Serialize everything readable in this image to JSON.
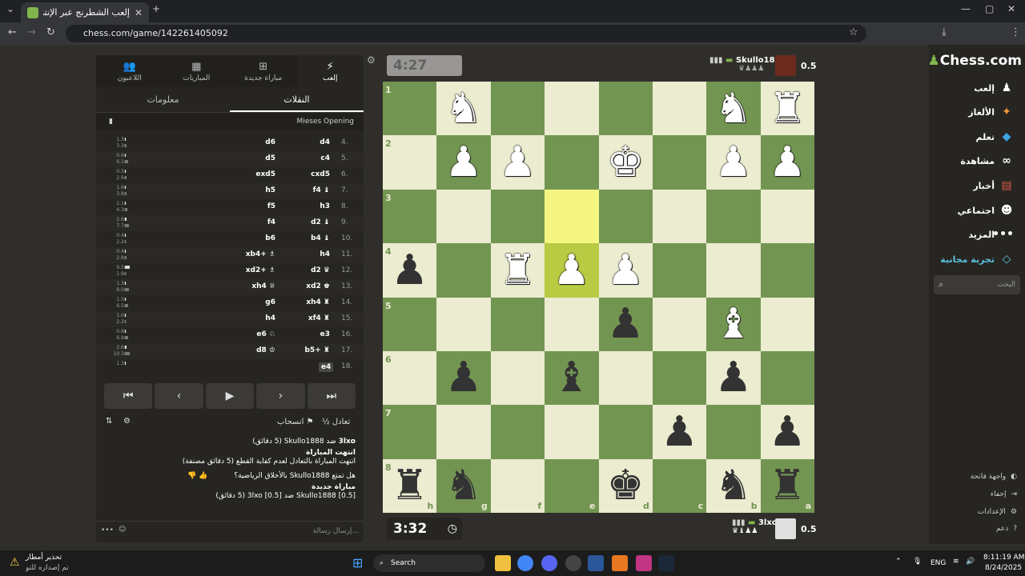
{
  "browser": {
    "tab_title": "إلعب الشطرنج عبر الإنترنت مجانًا",
    "url": "chess.com/game/142261405092"
  },
  "left_panel": {
    "top_tabs": [
      {
        "label": "إلعب",
        "icon": "bolt-icon"
      },
      {
        "label": "مباراة جديدة",
        "icon": "plus-icon"
      },
      {
        "label": "المباريات",
        "icon": "board-icon"
      },
      {
        "label": "اللاعبون",
        "icon": "people-icon"
      }
    ],
    "sub_tabs": [
      {
        "label": "النقلات"
      },
      {
        "label": "معلومات"
      }
    ],
    "opening": "Mieses Opening",
    "moves": [
      {
        "num": "4.",
        "white": "d4",
        "black": "d6",
        "wt": "1.3s",
        "bt": "3.3s"
      },
      {
        "num": "5.",
        "white": "c4",
        "black": "d5",
        "wt": "0.6s",
        "bt": "6.1s"
      },
      {
        "num": "6.",
        "white": "cxd5",
        "black": "exd5",
        "wt": "0.5s",
        "bt": "2.6s"
      },
      {
        "num": "7.",
        "white": "f4 ♝",
        "black": "h5",
        "wt": "1.6s",
        "bt": "3.8s"
      },
      {
        "num": "8.",
        "white": "h3",
        "black": "f5",
        "wt": "2.1s",
        "bt": "4.3s"
      },
      {
        "num": "9.",
        "white": "d2 ♝",
        "black": "f4",
        "wt": "2.6s",
        "bt": "7.7s"
      },
      {
        "num": "10.",
        "white": "b4 ♝",
        "black": "b6",
        "wt": "0.4s",
        "bt": "2.2s"
      },
      {
        "num": "11.",
        "white": "h4",
        "black": "xb4+ ♗",
        "wt": "0.4s",
        "bt": "2.8s"
      },
      {
        "num": "12.",
        "white": "d2 ♛",
        "black": "xd2+ ♗",
        "wt": "9.5s",
        "bt": "1.9s"
      },
      {
        "num": "13.",
        "white": "xd2 ♚",
        "black": "xh4 ♕",
        "wt": "1.3s",
        "bt": "8.0s"
      },
      {
        "num": "14.",
        "white": "xh4 ♜",
        "black": "g6",
        "wt": "1.5s",
        "bt": "6.5s"
      },
      {
        "num": "15.",
        "white": "xf4 ♜",
        "black": "h4",
        "wt": "1.0s",
        "bt": "2.2s"
      },
      {
        "num": "16.",
        "white": "e3",
        "black": "e6 ♘",
        "wt": "0.8s",
        "bt": "6.8s"
      },
      {
        "num": "17.",
        "white": "b5+ ♜",
        "black": "d8 ♔",
        "wt": "2.6s",
        "bt": "10.3s"
      },
      {
        "num": "18.",
        "white": "e4",
        "black": "",
        "wt": "1.3s",
        "bt": ""
      }
    ],
    "actions": {
      "draw": "½ تعادل",
      "resign": "انسحاب"
    },
    "chat": [
      {
        "bold": "3lxo",
        "text": " ضد Skullo1888 (5 دقائق)"
      },
      {
        "bold": "انتهت المباراة",
        "text": ""
      },
      {
        "bold": "",
        "text": "انتهت المباراة بالتعادل لعدم كفاية القطع (5 دقائق مصنفة)"
      },
      {
        "bold": "",
        "text": "هل تمتع Skullo1888 بالأخلاق الرياضية؟"
      },
      {
        "bold": "مباراة جديدة",
        "text": ""
      },
      {
        "bold": "",
        "text": "[0.5] Skullo1888 ضد [0.5] 3lxo (5 دقائق)"
      }
    ],
    "chat_placeholder": "إرسال رسالة..."
  },
  "game": {
    "top_clock": "4:27",
    "bottom_clock": "3:32",
    "top_player": {
      "name": "Skullo1888",
      "score": "0.5"
    },
    "bottom_player": {
      "name": "3lxo",
      "score": "0.5"
    },
    "rank_labels": [
      "1",
      "2",
      "3",
      "4",
      "5",
      "6",
      "7",
      "8"
    ],
    "file_labels": [
      "h",
      "g",
      "f",
      "e",
      "d",
      "c",
      "b",
      "a"
    ]
  },
  "sidebar": {
    "logo": "Chess.com",
    "items": [
      {
        "label": "إلعب",
        "icon": "pawn-icon"
      },
      {
        "label": "الألغاز",
        "icon": "puzzle-icon"
      },
      {
        "label": "تعلم",
        "icon": "graduation-icon"
      },
      {
        "label": "مشاهدة",
        "icon": "binoculars-icon"
      },
      {
        "label": "أخبار",
        "icon": "newspaper-icon"
      },
      {
        "label": "اجتماعي",
        "icon": "people-icon"
      },
      {
        "label": "المزيد",
        "icon": "more-icon"
      },
      {
        "label": "تجربة مجانية",
        "icon": "diamond-icon"
      }
    ],
    "search_placeholder": "البحث",
    "footer": [
      {
        "label": "واجهة فاتحة"
      },
      {
        "label": "إخفاء"
      },
      {
        "label": "الإعدادات"
      },
      {
        "label": "دعم"
      }
    ]
  },
  "taskbar": {
    "warning_title": "تحذير أمطار",
    "warning_sub": "تم إصداره للتو",
    "search": "Search",
    "lang": "ENG",
    "time": "8:11:19 AM",
    "date": "8/24/2025"
  },
  "colors": {
    "board_light": "#ebecd0",
    "board_dark": "#739552",
    "highlight_light": "#f5f682",
    "highlight_dark": "#b9ca43",
    "accent_green": "#81b64c"
  }
}
